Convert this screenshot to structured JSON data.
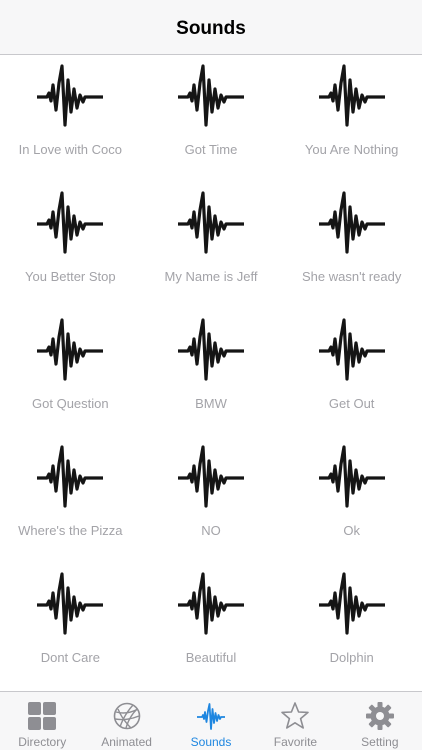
{
  "navbar": {
    "title": "Sounds"
  },
  "sounds": [
    "In Love with Coco",
    "Got Time",
    "You Are Nothing",
    "You Better Stop",
    "My Name is Jeff",
    "She wasn't ready",
    "Got Question",
    "BMW",
    "Get Out",
    "Where's the Pizza",
    "NO",
    "Ok",
    "Dont Care",
    "Beautiful",
    "Dolphin"
  ],
  "sound_icon": "waveform-icon",
  "tabs": [
    {
      "label": "Directory",
      "icon": "grid-icon",
      "active": false
    },
    {
      "label": "Animated",
      "icon": "globe-icon",
      "active": false
    },
    {
      "label": "Sounds",
      "icon": "waveform-icon",
      "active": true
    },
    {
      "label": "Favorite",
      "icon": "star-icon",
      "active": false
    },
    {
      "label": "Setting",
      "icon": "gear-icon",
      "active": false
    }
  ],
  "colors": {
    "active_tab": "#1e86e0",
    "inactive_tab": "#8e8e93",
    "label_gray": "#a3a3a8"
  }
}
